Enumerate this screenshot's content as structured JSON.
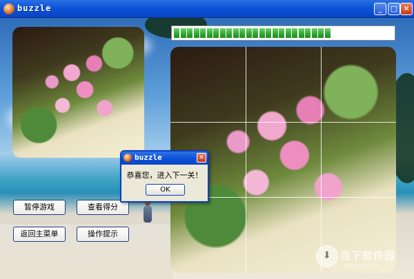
{
  "window": {
    "title": "buzzle"
  },
  "game": {
    "progress_percent": 70,
    "progress_segments_total": 34,
    "progress_segments_filled": 24,
    "grid": {
      "rows": 3,
      "cols": 3
    },
    "buttons": {
      "pause": "暂停游戏",
      "score": "查看得分",
      "menu": "返回主菜单",
      "hint": "操作提示"
    }
  },
  "dialog": {
    "title": "buzzle",
    "message": "恭喜您，进入下一关！",
    "ok": "OK"
  },
  "watermark": {
    "text": "当下软件园",
    "url": "downxia.com"
  }
}
